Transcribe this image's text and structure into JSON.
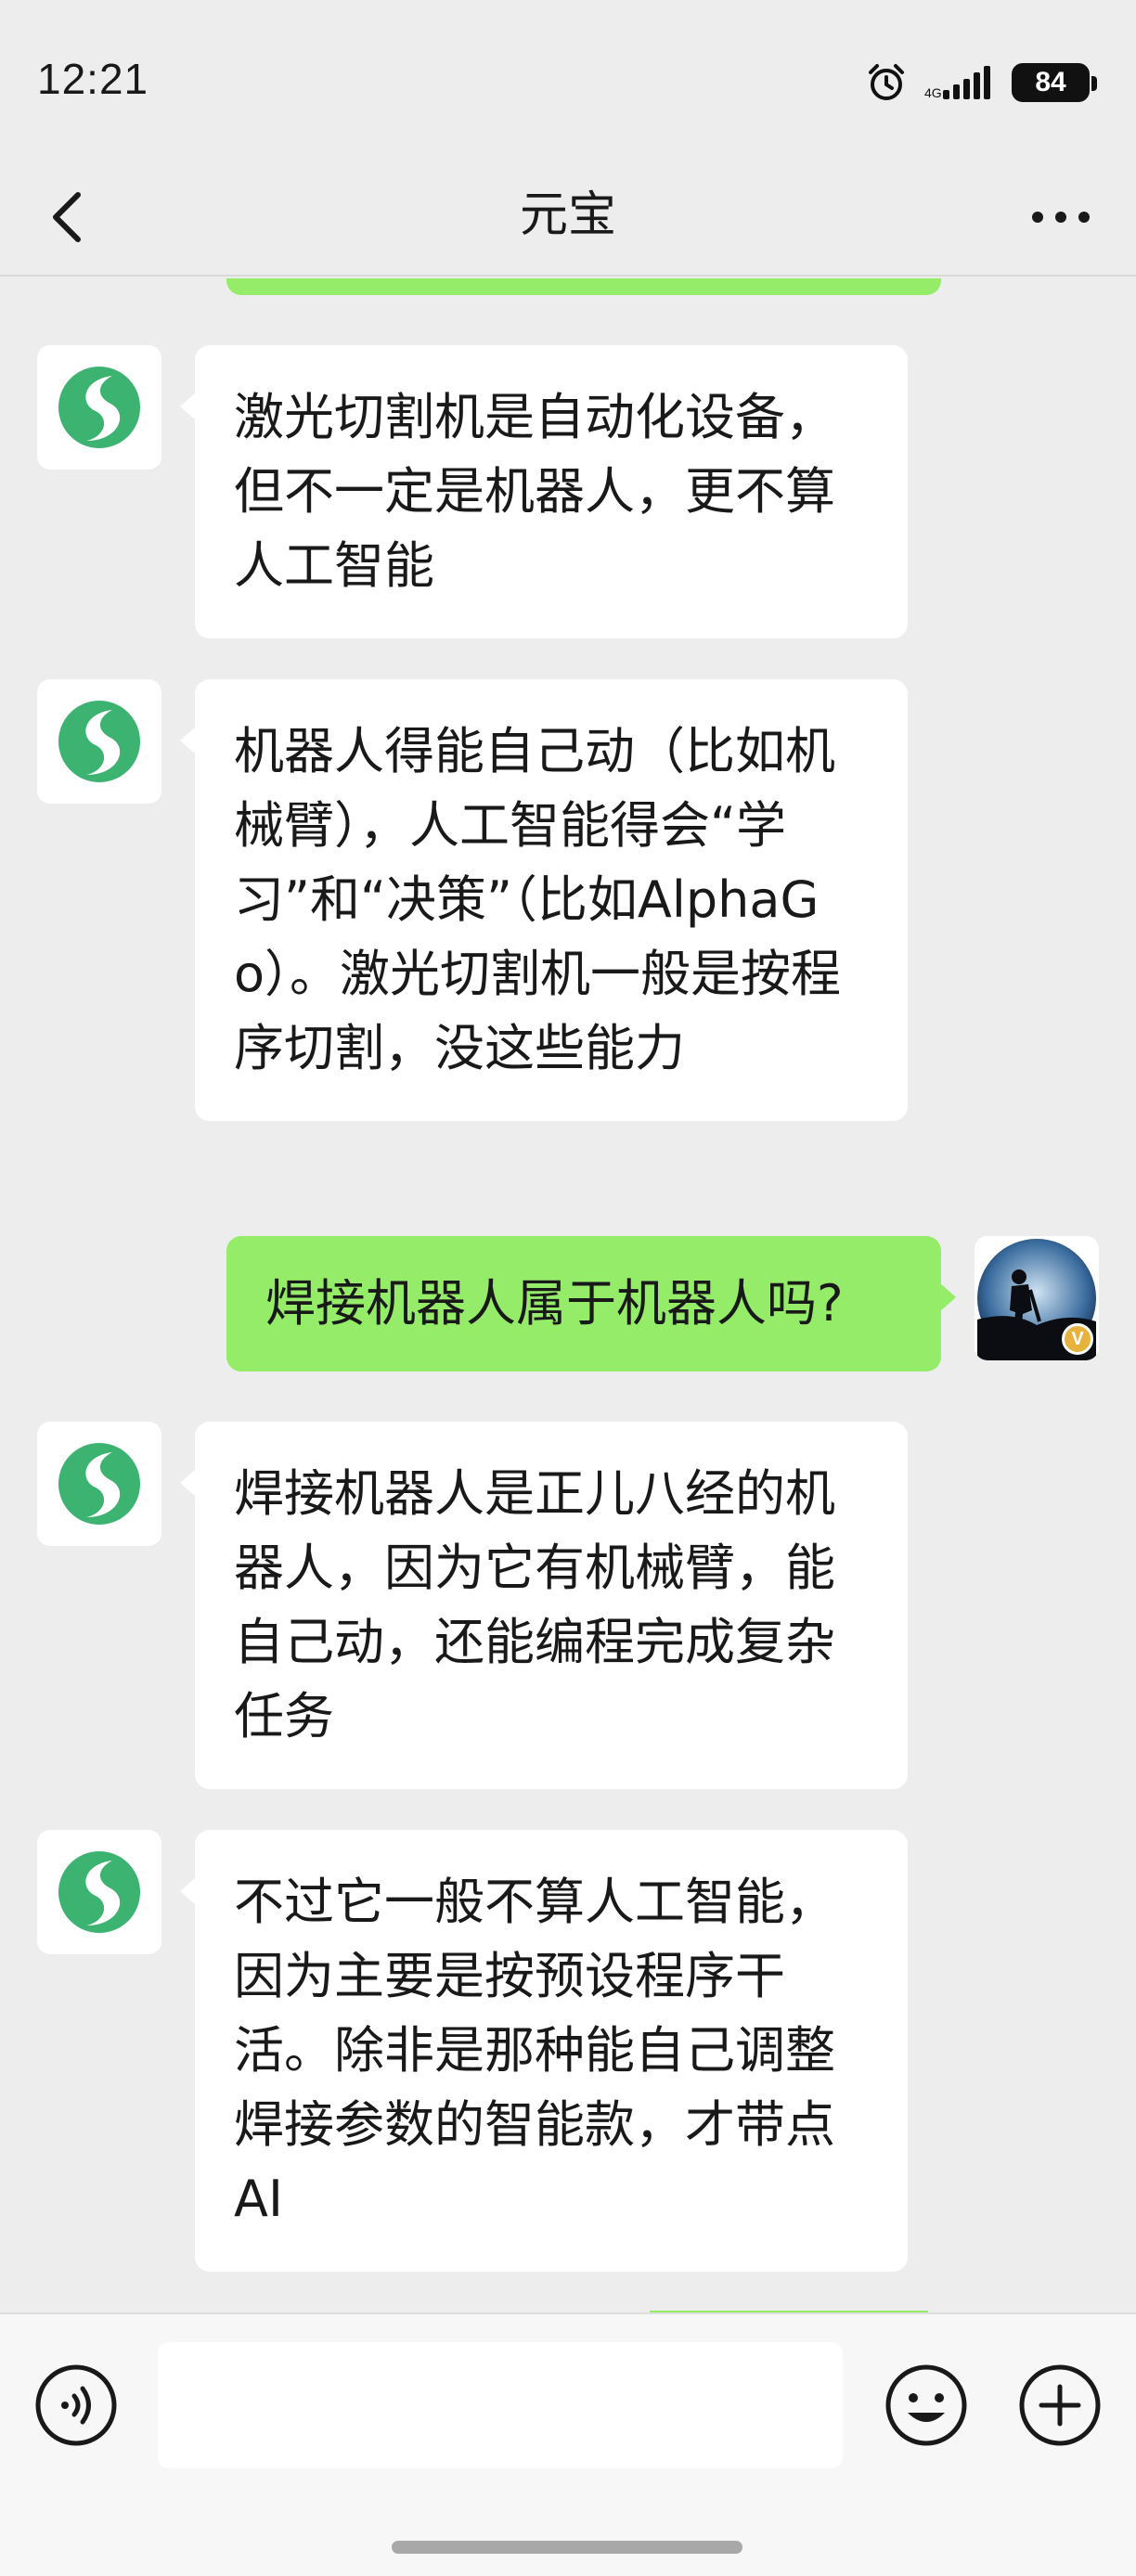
{
  "status_bar": {
    "time": "12:21",
    "battery": "84",
    "alarm_icon": "alarm-icon",
    "signal_icon": "signal-icon"
  },
  "nav": {
    "title": "元宝",
    "back_icon": "chevron-left-icon",
    "more_icon": "more-dots-icon"
  },
  "messages": [
    {
      "sender": "bot",
      "text": "激光切割机是自动化设备，但不一定是机器人，更不算人工智能"
    },
    {
      "sender": "bot",
      "text": "机器人得能自己动（比如机械臂），人工智能得会“学习”和“决策”（比如AlphaGo）。激光切割机一般是按程序切割，没这些能力"
    },
    {
      "sender": "user",
      "text": "焊接机器人属于机器人吗?"
    },
    {
      "sender": "bot",
      "text": "焊接机器人是正儿八经的机器人，因为它有机械臂，能自己动，还能编程完成复杂任务"
    },
    {
      "sender": "bot",
      "text": "不过它一般不算人工智能，因为主要是按预设程序干活。除非是那种能自己调整焊接参数的智能款，才带点AI"
    }
  ],
  "user_avatar": {
    "badge": "V"
  },
  "input_bar": {
    "voice_icon": "voice-icon",
    "emoji_icon": "emoji-icon",
    "add_icon": "plus-circle-icon",
    "input_value": ""
  },
  "colors": {
    "background": "#ededed",
    "bot_bubble": "#ffffff",
    "user_bubble": "#95ec69",
    "brand_green": "#3cb371"
  }
}
